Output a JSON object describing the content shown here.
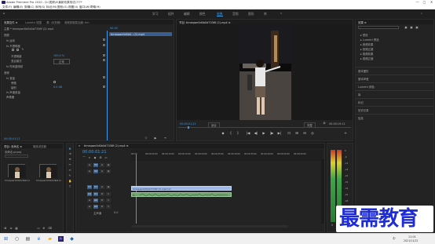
{
  "window": {
    "title": "Adobe Premiere Pro 2020 - D:\\视频\\0\\最新效果测试\\???*",
    "controls": [
      "—",
      "□",
      "✕"
    ]
  },
  "menu": [
    "文件(F)",
    "编辑(E)",
    "剪辑(C)",
    "序列(S)",
    "标记(M)",
    "图形(G)",
    "视图(V)",
    "窗口(W)",
    "帮助(H)"
  ],
  "workspaces": {
    "tabs": [
      "学习",
      "组件",
      "编辑",
      "颜色",
      "效果",
      "音频",
      "图形",
      "库"
    ],
    "active": "效果"
  },
  "effect_controls": {
    "tabs": [
      "效果控件 ≡",
      "Lumetri 范围",
      "源: (无剪辑)",
      "音频剪辑混合器: tim"
    ],
    "source": "主要 * timeqaer0d0b0d7336f (2).mp4",
    "clip": "timeqaer0d0b0...(2).mp4",
    "timecode_top": "00:00",
    "sections": {
      "video": "视频",
      "motion": "fx 运动",
      "opacity": "fx 不透明度",
      "opacity_label": "不透明度",
      "opacity_value": "100.0 %",
      "blend_label": "混合模式",
      "blend_value": "正常",
      "time_remap": "fx 时间重映射",
      "audio": "音频",
      "volume": "fx 音量",
      "bypass": "旁路",
      "level": "级别",
      "level_value": "0.0 dB",
      "channel_volume": "fx 声道音量",
      "panner": "声像器"
    },
    "timecode_bottom": "00:00:01:21"
  },
  "program_monitor": {
    "title": "节目: timeqaer0d0b0d7336f (2).mp4 ≡",
    "timecode": "00:00:01:21",
    "fit": "适合",
    "quality": "完整",
    "duration": "00:00:19:11",
    "clip_timecode": "00:00:05:08",
    "controls": [
      "◆",
      "{",
      "}",
      "|◀",
      "◀|",
      "▶",
      "|▶",
      "▶|",
      "⊡",
      "⊞",
      "⊟",
      "◎",
      "+"
    ]
  },
  "effects_panel": {
    "title": "效果 ≡",
    "items": [
      "▸ 预设",
      "▸ Lumetri 预设",
      "▸ 音频效果",
      "▸ 音频过渡",
      "▸ 视频效果",
      "▸ 视频过渡"
    ],
    "links": [
      "基本图形",
      "基本声音",
      "Lumetri 颜色",
      "库",
      "标记",
      "历史记录",
      "信息"
    ]
  },
  "project_panel": {
    "tabs": [
      "项目: 未命名 ≡",
      "媒体浏览器"
    ],
    "project_file": "未命名.prproj",
    "items": [
      {
        "name": "timeqaer0d0b0d7...",
        "duration": "19:11"
      },
      {
        "name": "timeqaer0d0b0d7...",
        "duration": "19:11"
      }
    ]
  },
  "timeline": {
    "title": "timeqaer0d0b0d7336f (2).mp4 ≡",
    "timecode": "00:00:01:21",
    "ruler": [
      "00:00",
      "00:00:05:00",
      "00:00:10:00",
      "00:00:15:00",
      "00:00:20:00",
      "00:00:25:00",
      "00:00:30:00",
      "00:00:35:00",
      "00:00:40:00",
      "00:00:45:00",
      "00:00:50:00"
    ],
    "tracks": [
      {
        "id": "V3",
        "kind": "video"
      },
      {
        "id": "V2",
        "kind": "video"
      },
      {
        "id": "V1",
        "kind": "video"
      },
      {
        "id": "A1",
        "kind": "audio"
      },
      {
        "id": "A2",
        "kind": "audio"
      },
      {
        "id": "A3",
        "kind": "audio"
      }
    ],
    "master": "主声道",
    "master_value": "0.0",
    "video_clip": "timeqaer0d0b0d7336f (2).mp4 [V]",
    "audio_clip": "fx"
  },
  "audio_meter": {
    "scale": [
      "0",
      "-6",
      "-12",
      "-18",
      "-24",
      "-30",
      "-36",
      "-42",
      "-48",
      "-54",
      "dB"
    ],
    "labels": [
      "S",
      "S"
    ]
  },
  "watermark": "最需教育",
  "taskbar": {
    "time": "11:01",
    "date": "2021/11/12",
    "lang": "中"
  },
  "colors": {
    "accent": "#3d9be9",
    "video_clip": "#9db7e6",
    "audio_clip": "#6fa36f",
    "watermark": "#1d2bd8"
  }
}
